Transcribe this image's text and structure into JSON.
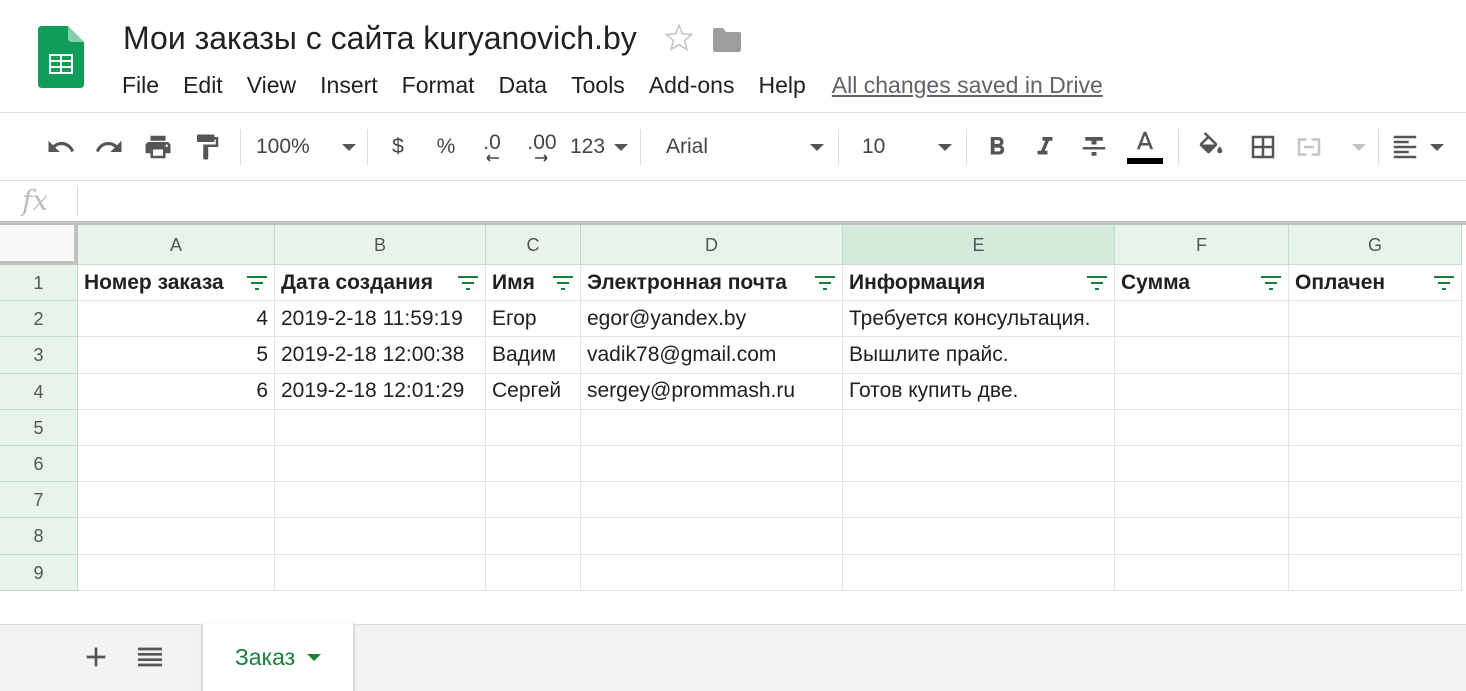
{
  "app": {
    "logo_icon": "google-sheets-logo",
    "title": "Мои заказы с сайта kuryanovich.by",
    "star_icon": "star-outline-icon",
    "folder_icon": "folder-icon"
  },
  "menu": {
    "items": [
      "File",
      "Edit",
      "View",
      "Insert",
      "Format",
      "Data",
      "Tools",
      "Add-ons",
      "Help"
    ],
    "save_status": "All changes saved in Drive"
  },
  "toolbar": {
    "zoom": "100%",
    "currency": "$",
    "percent": "%",
    "decrease_decimals": ".0",
    "increase_decimals": ".00",
    "more_formats": "123",
    "font": "Arial",
    "font_size": "10",
    "text_color": "#000000"
  },
  "formula_bar": {
    "fx_label": "fx",
    "value": ""
  },
  "grid": {
    "columns": [
      "A",
      "B",
      "C",
      "D",
      "E",
      "F",
      "G"
    ],
    "selected_column": "E",
    "rows": [
      "1",
      "2",
      "3",
      "4",
      "5",
      "6",
      "7",
      "8",
      "9"
    ],
    "header_row": [
      "Номер заказа",
      "Дата создания",
      "Имя",
      "Электронная почта",
      "Информация",
      "Сумма",
      "Оплачен"
    ],
    "data": [
      [
        "4",
        "2019-2-18 11:59:19",
        "Егор",
        "egor@yandex.by",
        "Требуется консультация.",
        "",
        ""
      ],
      [
        "5",
        "2019-2-18 12:00:38",
        "Вадим",
        "vadik78@gmail.com",
        "Вышлите прайс.",
        "",
        ""
      ],
      [
        "6",
        "2019-2-18 12:01:29",
        "Сергей",
        "sergey@prommash.ru",
        "Готов купить две.",
        "",
        ""
      ]
    ]
  },
  "sheets": {
    "active": "Заказ"
  },
  "colors": {
    "accent_green": "#188038",
    "header_bg": "#e6f4ea",
    "selected_header_bg": "#d2ebdb"
  }
}
